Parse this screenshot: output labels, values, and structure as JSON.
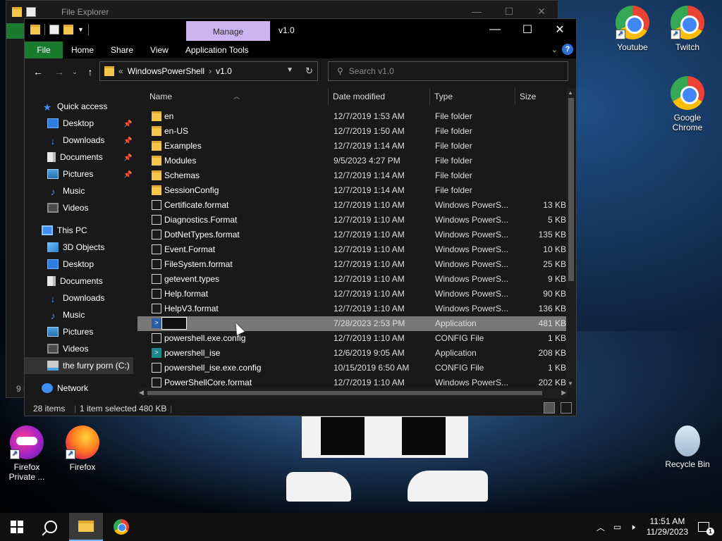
{
  "desktop": {
    "icons": [
      {
        "label": "Youtube"
      },
      {
        "label": "Twitch"
      },
      {
        "label": "Google Chrome"
      },
      {
        "label": "Firefox Private ..."
      },
      {
        "label": "Firefox"
      },
      {
        "label": "Recycle Bin"
      }
    ]
  },
  "bg_window": {
    "title": "File Explorer",
    "status": "9 i"
  },
  "window": {
    "title": "v1.0",
    "manage_label": "Manage",
    "controls": {
      "minimize": "—",
      "maximize": "☐",
      "close": "✕"
    }
  },
  "ribbon": {
    "tabs": [
      "File",
      "Home",
      "Share",
      "View",
      "Application Tools"
    ]
  },
  "address": {
    "overflow": "«",
    "crumbs": [
      "WindowsPowerShell",
      "v1.0"
    ],
    "separator": "›"
  },
  "search": {
    "placeholder": "Search v1.0"
  },
  "sidebar": {
    "items": [
      {
        "label": "Quick access"
      },
      {
        "label": "Desktop"
      },
      {
        "label": "Downloads"
      },
      {
        "label": "Documents"
      },
      {
        "label": "Pictures"
      },
      {
        "label": "Music"
      },
      {
        "label": "Videos"
      },
      {
        "label": "This PC"
      },
      {
        "label": "3D Objects"
      },
      {
        "label": "Desktop"
      },
      {
        "label": "Documents"
      },
      {
        "label": "Downloads"
      },
      {
        "label": "Music"
      },
      {
        "label": "Pictures"
      },
      {
        "label": "Videos"
      },
      {
        "label": "the furry porn (C:)"
      },
      {
        "label": "Network"
      }
    ]
  },
  "columns": {
    "name": "Name",
    "date": "Date modified",
    "type": "Type",
    "size": "Size"
  },
  "files": [
    {
      "name": "en",
      "date": "12/7/2019 1:53 AM",
      "type": "File folder",
      "size": "",
      "kind": "folder"
    },
    {
      "name": "en-US",
      "date": "12/7/2019 1:50 AM",
      "type": "File folder",
      "size": "",
      "kind": "folder"
    },
    {
      "name": "Examples",
      "date": "12/7/2019 1:14 AM",
      "type": "File folder",
      "size": "",
      "kind": "folder"
    },
    {
      "name": "Modules",
      "date": "9/5/2023 4:27 PM",
      "type": "File folder",
      "size": "",
      "kind": "folder"
    },
    {
      "name": "Schemas",
      "date": "12/7/2019 1:14 AM",
      "type": "File folder",
      "size": "",
      "kind": "folder"
    },
    {
      "name": "SessionConfig",
      "date": "12/7/2019 1:14 AM",
      "type": "File folder",
      "size": "",
      "kind": "folder"
    },
    {
      "name": "Certificate.format",
      "date": "12/7/2019 1:10 AM",
      "type": "Windows PowerS...",
      "size": "13 KB",
      "kind": "file"
    },
    {
      "name": "Diagnostics.Format",
      "date": "12/7/2019 1:10 AM",
      "type": "Windows PowerS...",
      "size": "5 KB",
      "kind": "file"
    },
    {
      "name": "DotNetTypes.format",
      "date": "12/7/2019 1:10 AM",
      "type": "Windows PowerS...",
      "size": "135 KB",
      "kind": "file"
    },
    {
      "name": "Event.Format",
      "date": "12/7/2019 1:10 AM",
      "type": "Windows PowerS...",
      "size": "10 KB",
      "kind": "file"
    },
    {
      "name": "FileSystem.format",
      "date": "12/7/2019 1:10 AM",
      "type": "Windows PowerS...",
      "size": "25 KB",
      "kind": "file"
    },
    {
      "name": "getevent.types",
      "date": "12/7/2019 1:10 AM",
      "type": "Windows PowerS...",
      "size": "9 KB",
      "kind": "file"
    },
    {
      "name": "Help.format",
      "date": "12/7/2019 1:10 AM",
      "type": "Windows PowerS...",
      "size": "90 KB",
      "kind": "file"
    },
    {
      "name": "HelpV3.format",
      "date": "12/7/2019 1:10 AM",
      "type": "Windows PowerS...",
      "size": "136 KB",
      "kind": "file"
    },
    {
      "name": "",
      "date": "7/28/2023 2:53 PM",
      "type": "Application",
      "size": "481 KB",
      "kind": "app",
      "selected": true
    },
    {
      "name": "powershell.exe.config",
      "date": "12/7/2019 1:10 AM",
      "type": "CONFIG File",
      "size": "1 KB",
      "kind": "file"
    },
    {
      "name": "powershell_ise",
      "date": "12/6/2019 9:05 AM",
      "type": "Application",
      "size": "208 KB",
      "kind": "ise"
    },
    {
      "name": "powershell_ise.exe.config",
      "date": "10/15/2019 6:50 AM",
      "type": "CONFIG File",
      "size": "1 KB",
      "kind": "file"
    },
    {
      "name": "PowerShellCore.format",
      "date": "12/7/2019 1:10 AM",
      "type": "Windows PowerS...",
      "size": "202 KB",
      "kind": "file"
    }
  ],
  "status": {
    "count": "28 items",
    "selected": "1 item selected  480 KB"
  },
  "taskbar": {
    "time": "11:51 AM",
    "date": "11/29/2023"
  }
}
